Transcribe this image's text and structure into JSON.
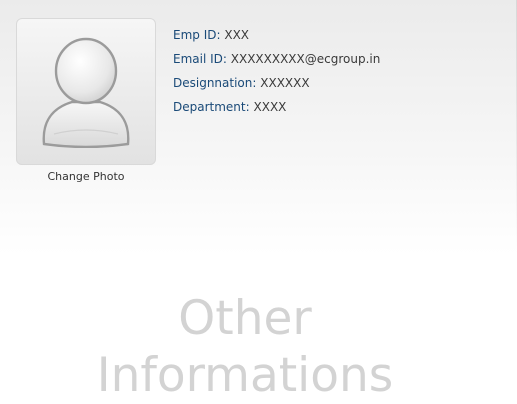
{
  "profile": {
    "change_photo_label": "Change Photo",
    "avatar_icon": "user-silhouette-icon",
    "fields": [
      {
        "label": "Emp ID:",
        "value": "XXX"
      },
      {
        "label": "Email ID:",
        "value": "XXXXXXXXX@ecgroup.in"
      },
      {
        "label": "Designnation:",
        "value": "XXXXXX"
      },
      {
        "label": "Department:",
        "value": "XXXX"
      }
    ]
  },
  "other": {
    "line1": "Other",
    "line2": "Informations"
  },
  "colors": {
    "label": "#1a4a78",
    "value": "#3a3a3a",
    "watermark_text": "#d3d3d3"
  }
}
